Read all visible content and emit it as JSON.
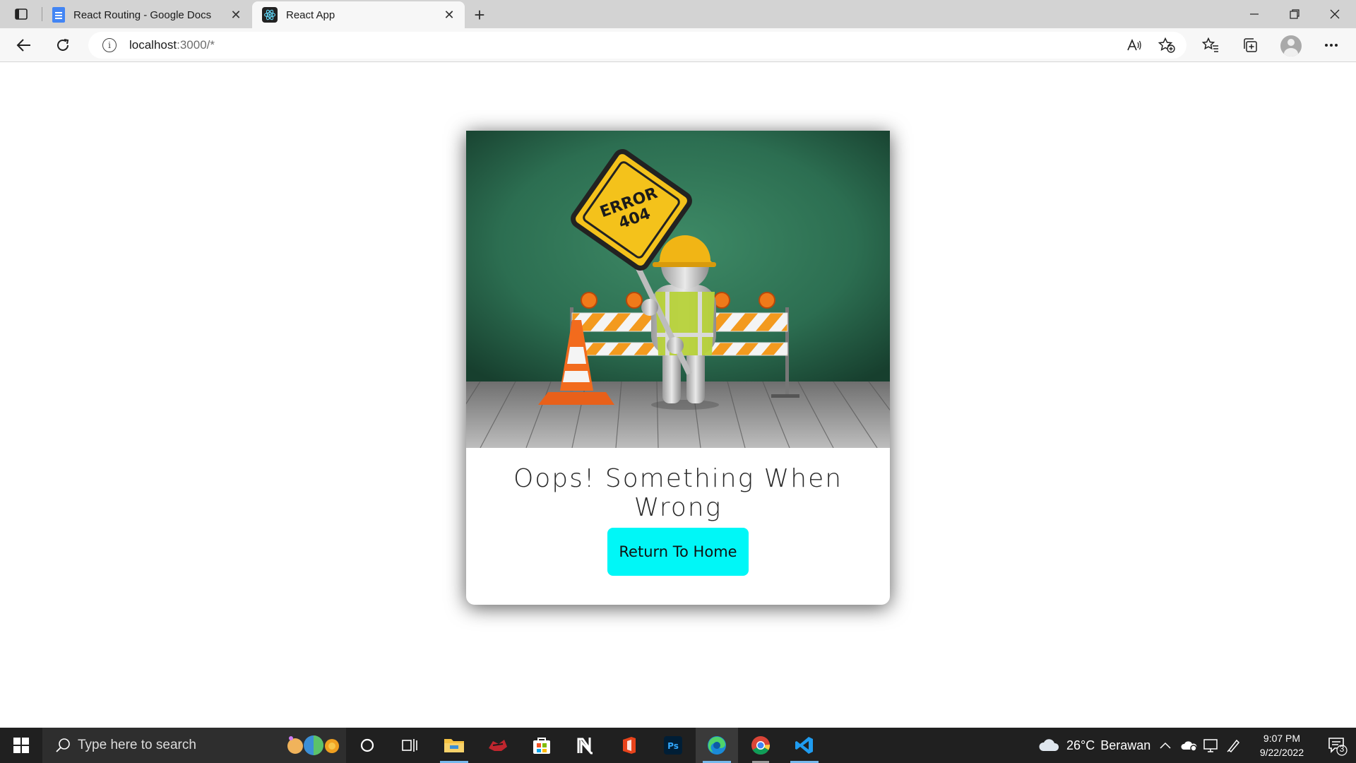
{
  "browser": {
    "tabs": [
      {
        "label": "React Routing - Google Docs",
        "active": false
      },
      {
        "label": "React App",
        "active": true
      }
    ],
    "close_glyph": "✕",
    "new_tab_glyph": "+",
    "address": {
      "host": "localhost",
      "rest": ":3000/*"
    },
    "icons": [
      "tab-actions-icon",
      "back-icon",
      "refresh-icon",
      "info-icon",
      "read-aloud-icon",
      "add-favorite-icon",
      "favorites-icon",
      "collections-icon",
      "profile-icon",
      "more-icon"
    ]
  },
  "page": {
    "image_text": "ERROR\n404",
    "headline": "Oops! Something When Wrong",
    "button_label": "Return To Home",
    "button_color": "#00f7f7"
  },
  "taskbar": {
    "search_placeholder": "Type here to search",
    "weather": {
      "temp": "26°C",
      "condition": "Berawan"
    },
    "time": "9:07 PM",
    "date": "9/22/2022",
    "notification_count": "3",
    "apps": [
      "task-view",
      "file-explorer",
      "game-app",
      "microsoft-store",
      "notion",
      "office",
      "photoshop",
      "edge",
      "chrome",
      "vscode"
    ]
  }
}
